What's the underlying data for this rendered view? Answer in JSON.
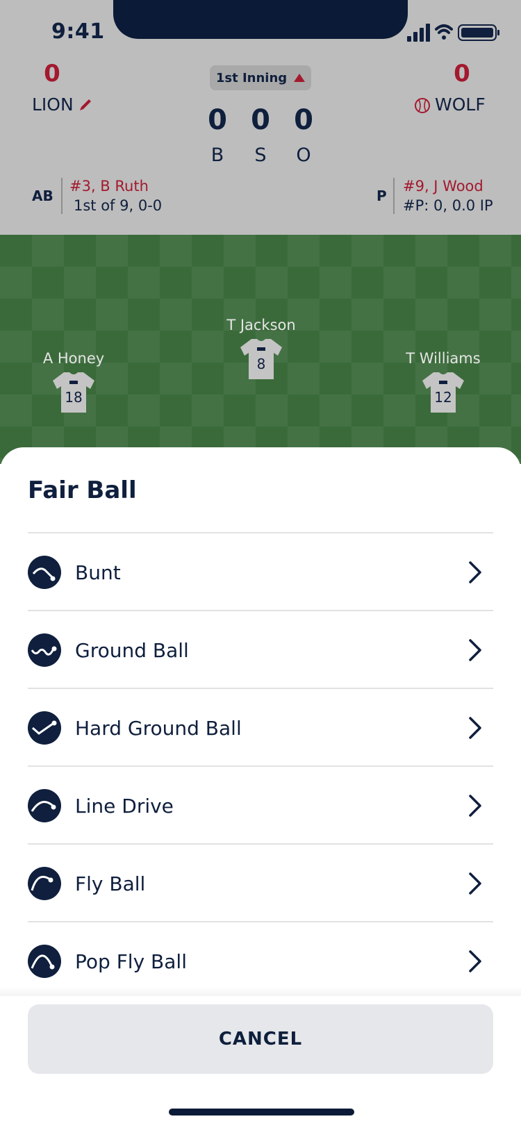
{
  "status_bar": {
    "time": "9:41"
  },
  "scoreboard": {
    "home": {
      "score": "0",
      "name": "LION"
    },
    "away": {
      "score": "0",
      "name": "WOLF"
    },
    "inning": "1st Inning",
    "count": [
      {
        "value": "0",
        "label": "B"
      },
      {
        "value": "0",
        "label": "S"
      },
      {
        "value": "0",
        "label": "O"
      }
    ],
    "at_bat": {
      "label": "AB",
      "player": "#3, B Ruth",
      "detail": "1st of 9, 0-0"
    },
    "pitcher": {
      "label": "P",
      "player": "#9, J Wood",
      "detail": "#P: 0, 0.0 IP"
    }
  },
  "field": {
    "players": [
      {
        "name": "A Honey",
        "number": "18"
      },
      {
        "name": "T Jackson",
        "number": "8"
      },
      {
        "name": "T Williams",
        "number": "12"
      }
    ]
  },
  "sheet": {
    "title": "Fair Ball",
    "options": [
      {
        "label": "Bunt",
        "icon": "bunt-icon"
      },
      {
        "label": "Ground Ball",
        "icon": "ground-ball-icon"
      },
      {
        "label": "Hard Ground Ball",
        "icon": "hard-ground-ball-icon"
      },
      {
        "label": "Line Drive",
        "icon": "line-drive-icon"
      },
      {
        "label": "Fly Ball",
        "icon": "fly-ball-icon"
      },
      {
        "label": "Pop Fly Ball",
        "icon": "pop-fly-ball-icon"
      }
    ],
    "cancel_label": "CANCEL"
  },
  "colors": {
    "navy": "#0f1f3d",
    "accent_red": "#a3192e",
    "field_green": "#3a6a3a"
  }
}
